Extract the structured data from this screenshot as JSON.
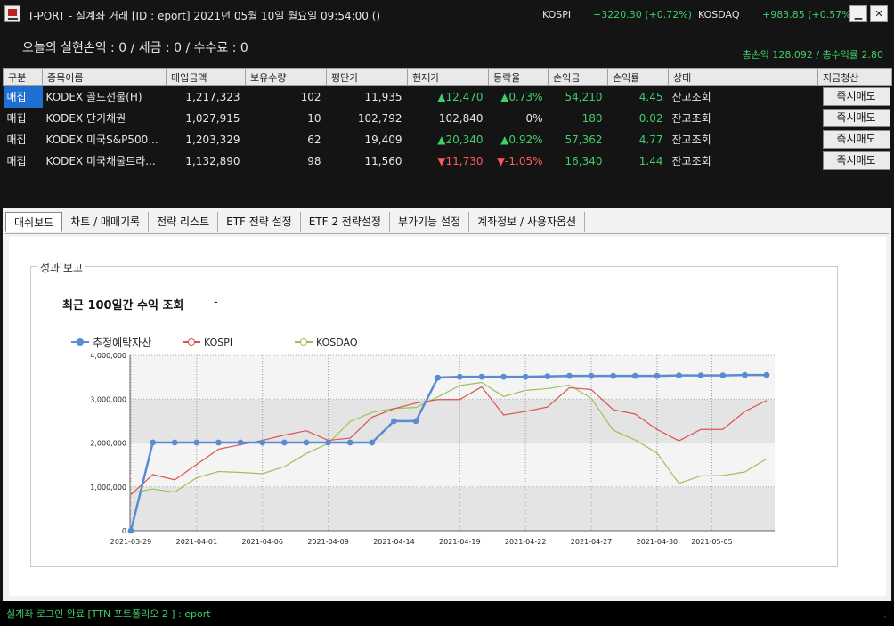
{
  "window": {
    "title": "T-PORT - 실계좌 거래 [ID : eport] 2021년 05월 10일 월요일 09:54:00 ()",
    "kospi_label": "KOSPI",
    "kospi_value": "+3220.30 (+0.72%)",
    "kosdaq_label": "KOSDAQ",
    "kosdaq_value": "+983.85 (+0.57%)",
    "minimize_icon": "minimize-icon",
    "close_icon": "close-icon",
    "minimize_glyph": "▁",
    "close_glyph": "✕"
  },
  "realized_pnl": "오늘의 실현손익 : 0 / 세금 : 0 / 수수료 : 0",
  "summary": "총손익 128,092 / 총수익률 2.80",
  "holdings": {
    "headers": [
      "구분",
      "종목이름",
      "매입금액",
      "보유수량",
      "평단가",
      "현재가",
      "등락율",
      "손익금",
      "손익률",
      "상태",
      "지금청산"
    ],
    "rows": [
      {
        "type": "매집",
        "name": "KODEX 골드선물(H)",
        "buy_amount": "1,217,323",
        "qty": "102",
        "avg_price": "11,935",
        "current": "▲12,470",
        "change": "▲0.73%",
        "pnl": "54,210",
        "pnl_rate": "4.45",
        "status": "잔고조회",
        "action": "즉시매도",
        "dir": "up"
      },
      {
        "type": "매집",
        "name": "KODEX 단기채권",
        "buy_amount": "1,027,915",
        "qty": "10",
        "avg_price": "102,792",
        "current": "102,840",
        "change": "0%",
        "pnl": "180",
        "pnl_rate": "0.02",
        "status": "잔고조회",
        "action": "즉시매도",
        "dir": "flat"
      },
      {
        "type": "매집",
        "name": "KODEX 미국S&P500...",
        "buy_amount": "1,203,329",
        "qty": "62",
        "avg_price": "19,409",
        "current": "▲20,340",
        "change": "▲0.92%",
        "pnl": "57,362",
        "pnl_rate": "4.77",
        "status": "잔고조회",
        "action": "즉시매도",
        "dir": "up"
      },
      {
        "type": "매집",
        "name": "KODEX 미국채울트라...",
        "buy_amount": "1,132,890",
        "qty": "98",
        "avg_price": "11,560",
        "current": "▼11,730",
        "change": "▼-1.05%",
        "pnl": "16,340",
        "pnl_rate": "1.44",
        "status": "잔고조회",
        "action": "즉시매도",
        "dir": "down"
      }
    ]
  },
  "tabs": [
    "대쉬보드",
    "차트 / 매매기록",
    "전략 리스트",
    "ETF 전략 설정",
    "ETF 2 전략설정",
    "부가기능 설정",
    "계좌정보 / 사용자옵션"
  ],
  "active_tab": 0,
  "report": {
    "group_title": "성과 보고",
    "title": "최근 100일간 수익 조회",
    "dash": "-"
  },
  "colors": {
    "asset": "#5b8bd1",
    "kospi": "#d9534f",
    "kosdaq": "#99c25a",
    "up": "#3fcf6a",
    "down": "#ff5a5a"
  },
  "chart_data": {
    "type": "line",
    "x": [
      "2021-03-29",
      "2021-03-30",
      "2021-03-31",
      "2021-04-01",
      "2021-04-02",
      "2021-04-05",
      "2021-04-06",
      "2021-04-07",
      "2021-04-08",
      "2021-04-09",
      "2021-04-12",
      "2021-04-13",
      "2021-04-14",
      "2021-04-15",
      "2021-04-16",
      "2021-04-19",
      "2021-04-20",
      "2021-04-21",
      "2021-04-22",
      "2021-04-23",
      "2021-04-26",
      "2021-04-27",
      "2021-04-28",
      "2021-04-29",
      "2021-04-30",
      "2021-05-03",
      "2021-05-04",
      "2021-05-06",
      "2021-05-07",
      "2021-05-10"
    ],
    "xtick_labels": [
      "2021-03-29",
      "2021-04-01",
      "2021-04-06",
      "2021-04-09",
      "2021-04-14",
      "2021-04-19",
      "2021-04-22",
      "2021-04-27",
      "2021-04-30",
      "2021-05-05"
    ],
    "series": [
      {
        "name": "추정예탁자산",
        "values": [
          0,
          2010000,
          2010000,
          2010000,
          2010000,
          2010000,
          2010000,
          2010000,
          2010000,
          2010000,
          2010000,
          2010000,
          2500000,
          2500000,
          3490000,
          3510000,
          3510000,
          3510000,
          3510000,
          3520000,
          3530000,
          3530000,
          3530000,
          3530000,
          3530000,
          3540000,
          3540000,
          3540000,
          3550000,
          3550000
        ]
      },
      {
        "name": "KOSPI",
        "values": [
          820000,
          1280000,
          1160000,
          1510000,
          1860000,
          1960000,
          2060000,
          2180000,
          2280000,
          2060000,
          2110000,
          2590000,
          2780000,
          2910000,
          2990000,
          2990000,
          3280000,
          2640000,
          2720000,
          2820000,
          3260000,
          3220000,
          2760000,
          2660000,
          2310000,
          2050000,
          2310000,
          2310000,
          2720000,
          2970000
        ]
      },
      {
        "name": "KOSDAQ",
        "values": [
          860000,
          950000,
          880000,
          1210000,
          1350000,
          1330000,
          1300000,
          1460000,
          1760000,
          1990000,
          2490000,
          2700000,
          2790000,
          2810000,
          3050000,
          3310000,
          3380000,
          3060000,
          3200000,
          3240000,
          3320000,
          3020000,
          2290000,
          2070000,
          1770000,
          1080000,
          1250000,
          1260000,
          1340000,
          1640000
        ]
      }
    ],
    "ylim": [
      0,
      4000000
    ],
    "yticks": [
      "0",
      "1,000,000",
      "2,000,000",
      "3,000,000",
      "4,000,000"
    ],
    "grid": true,
    "legend": "top-left"
  },
  "status": "실계좌 로그인 완료 [TTN 포트폴리오 2 ] : eport",
  "resize_glyph": "⋰"
}
